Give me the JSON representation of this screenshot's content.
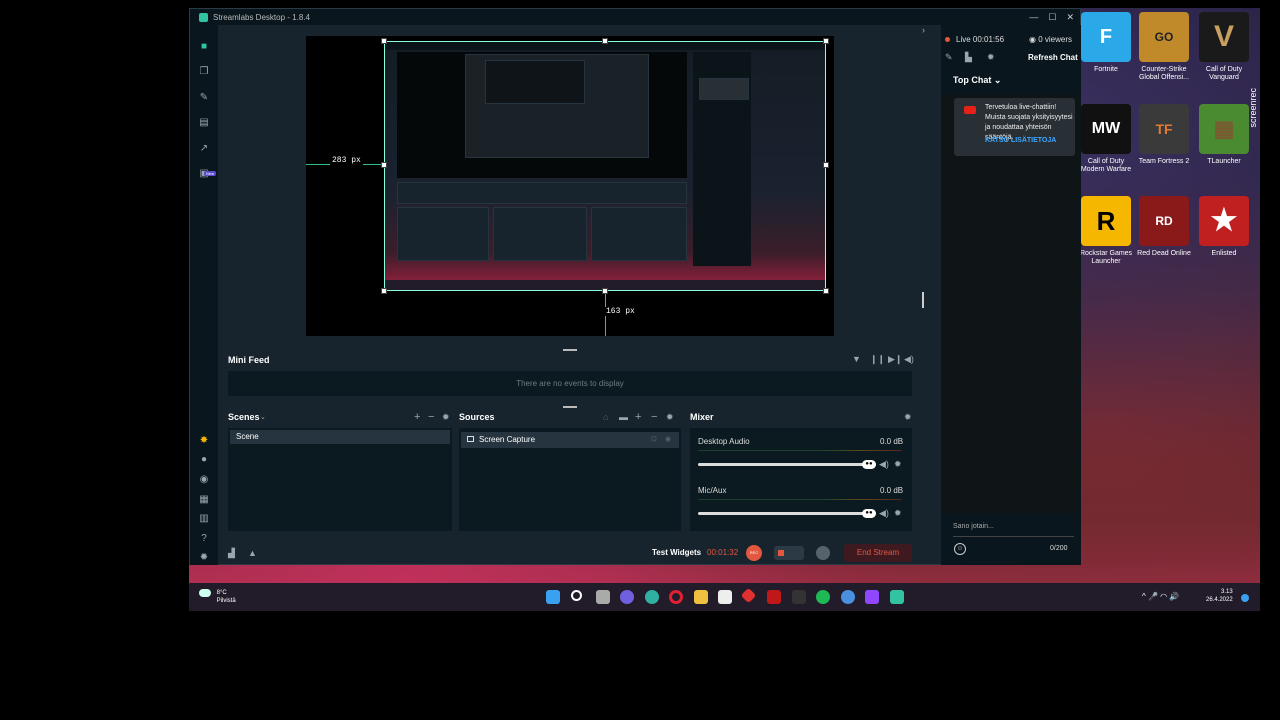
{
  "app": {
    "title": "Streamlabs Desktop - 1.8.4",
    "window_controls": [
      "—",
      "☐",
      "✕"
    ]
  },
  "leftnav": {
    "top_icons": [
      "studio-icon",
      "layout-icon",
      "themes-icon",
      "store-icon",
      "dashboard-icon",
      "highlighter-icon"
    ],
    "new_badge": "New",
    "bottom_icons": [
      "dev-icon",
      "help-icon",
      "chat-icon",
      "apps-icon",
      "layout-icon",
      "help-circle-icon",
      "settings-icon"
    ]
  },
  "preview": {
    "left_distance": "283 px",
    "bottom_distance": "163 px"
  },
  "minifeed": {
    "title": "Mini Feed",
    "empty_text": "There are no events to display"
  },
  "scenes": {
    "title": "Scenes",
    "items": [
      "Scene"
    ]
  },
  "sources": {
    "title": "Sources",
    "items": [
      "Screen Capture"
    ]
  },
  "mixer": {
    "title": "Mixer",
    "channels": [
      {
        "name": "Desktop Audio",
        "db": "0.0 dB"
      },
      {
        "name": "Mic/Aux",
        "db": "0.0 dB"
      }
    ]
  },
  "footer": {
    "test_widgets": "Test Widgets",
    "timer": "00:01:32",
    "rec_label": "REC",
    "end_stream": "End Stream"
  },
  "chat": {
    "live": "Live 00:01:56",
    "viewers": "0 viewers",
    "refresh": "Refresh Chat",
    "top_chat": "Top Chat",
    "message": "Tervetuloa live-chattiin! Muista suojata yksityisyytesi ja noudattaa yhteisön sääntöjä.",
    "message_link": "KATSO LISÄTIETOJA",
    "input_placeholder": "Sano jotain...",
    "char_count": "0/200"
  },
  "desktop": {
    "icons": [
      {
        "label": "Fortnite",
        "glyph": "F",
        "color": "#2aa8e8"
      },
      {
        "label": "Counter-Strike Global Offensi...",
        "glyph": "GO",
        "color": "#c08a2a"
      },
      {
        "label": "Call of Duty Vanguard",
        "glyph": "V",
        "color": "#1a1a1a"
      },
      {
        "label": "Call of Duty Modern Warfare",
        "glyph": "MW",
        "color": "#111111"
      },
      {
        "label": "Team Fortress 2",
        "glyph": "TF",
        "color": "#3a3a3a"
      },
      {
        "label": "TLauncher",
        "glyph": "▦",
        "color": "#4a8a30"
      },
      {
        "label": "Rockstar Games Launcher",
        "glyph": "R",
        "color": "#f5b700"
      },
      {
        "label": "Red Dead Online",
        "glyph": "RD",
        "color": "#8a1a1a"
      },
      {
        "label": "Enlisted",
        "glyph": "★",
        "color": "#c02020"
      }
    ],
    "screenrec": "screenrec"
  },
  "taskbar": {
    "weather_temp": "8°C",
    "weather_desc": "Pilvistä",
    "time": "3.13",
    "date": "26.4.2022",
    "tray": "^ 🎤 ◠ 🔊"
  }
}
